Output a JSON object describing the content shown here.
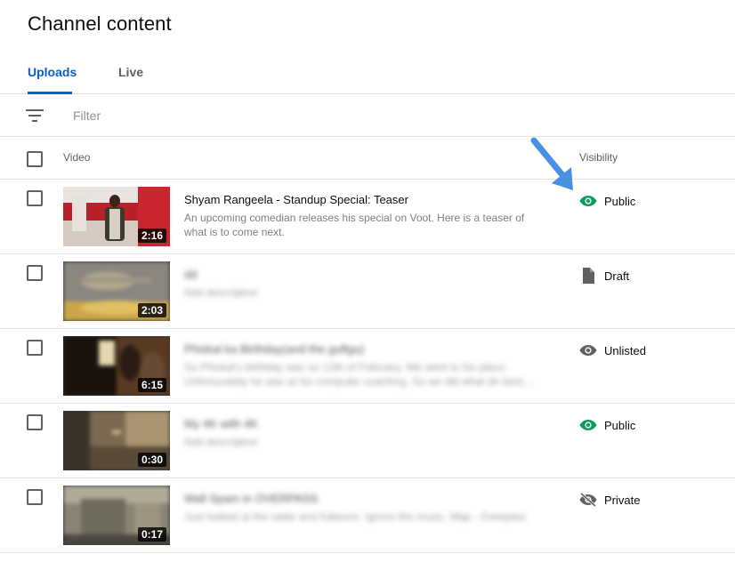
{
  "page": {
    "title": "Channel content"
  },
  "tabs": [
    {
      "label": "Uploads",
      "active": true
    },
    {
      "label": "Live",
      "active": false
    }
  ],
  "filter": {
    "placeholder": "Filter",
    "icon": "filter-icon"
  },
  "table": {
    "columns": {
      "video": "Video",
      "visibility": "Visibility"
    },
    "rows": [
      {
        "title": "Shyam Rangeela - Standup Special: Teaser",
        "description": "An upcoming comedian releases his special on Voot. Here is a teaser of what is to come next.",
        "duration": "2:16",
        "visibility": "Public",
        "visibility_icon": "eye-icon",
        "visibility_color": "#0f9d58",
        "blurred": false
      },
      {
        "title": "dd",
        "description": "Add description",
        "duration": "2:03",
        "visibility": "Draft",
        "visibility_icon": "document-icon",
        "visibility_color": "#606060",
        "blurred": true
      },
      {
        "title": "Phiskal ka Birthday(and the guftgu)",
        "description": "So Phiskal's birthday was on 12th of February. We went to his place. Unfortunately he was at his computer coaching. So we did what do best,...",
        "duration": "6:15",
        "visibility": "Unlisted",
        "visibility_icon": "eye-icon",
        "visibility_color": "#606060",
        "blurred": true
      },
      {
        "title": "My 4K with 4K",
        "description": "Add description",
        "duration": "0:30",
        "visibility": "Public",
        "visibility_icon": "eye-icon",
        "visibility_color": "#0f9d58",
        "blurred": true
      },
      {
        "title": "Wall Spam in OVERPASS",
        "description": "Just looked at the radar and Kaboom. Ignore the music. Map - Overpass",
        "duration": "0:17",
        "visibility": "Private",
        "visibility_icon": "eye-off-icon",
        "visibility_color": "#606060",
        "blurred": true
      }
    ]
  },
  "colors": {
    "accent": "#065fd4",
    "public": "#0f9d58",
    "annotation_arrow": "#4a90e2"
  }
}
